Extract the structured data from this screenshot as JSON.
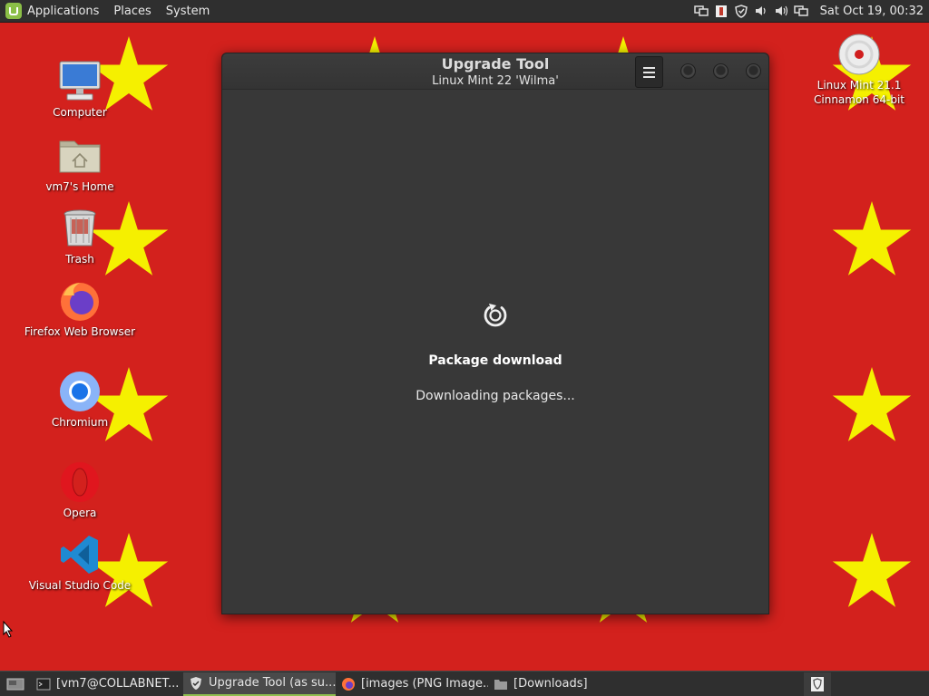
{
  "top_panel": {
    "menus": [
      {
        "label": "Applications"
      },
      {
        "label": "Places"
      },
      {
        "label": "System"
      }
    ],
    "tray_icons": [
      "network-icon",
      "notes-icon",
      "shield-icon",
      "volume-icon",
      "volume-icon",
      "network-icon"
    ],
    "clock": "Sat Oct 19, 00:32"
  },
  "desktop": {
    "icons": [
      {
        "label": "Computer"
      },
      {
        "label": "vm7's Home"
      },
      {
        "label": "Trash"
      },
      {
        "label": "Firefox Web Browser"
      },
      {
        "label": "Chromium"
      },
      {
        "label": "Opera"
      },
      {
        "label": "Visual Studio Code"
      }
    ],
    "disc": {
      "label": "Linux Mint 21.1 Cinnamon 64-bit"
    }
  },
  "dialog": {
    "title": "Upgrade Tool",
    "subtitle": "Linux Mint 22 'Wilma'",
    "status_title": "Package download",
    "status_text": "Downloading packages..."
  },
  "taskbar": {
    "tasks": [
      {
        "label": "[vm7@COLLABNET..."
      },
      {
        "label": "Upgrade Tool (as su..."
      },
      {
        "label": "[images (PNG Image..."
      },
      {
        "label": "[Downloads]"
      }
    ]
  },
  "colors": {
    "wallpaper": "#d3211d",
    "stars": "#f5f000",
    "panel": "#2f2f2f",
    "dialog": "#383838",
    "accent": "#8fbe4f"
  }
}
